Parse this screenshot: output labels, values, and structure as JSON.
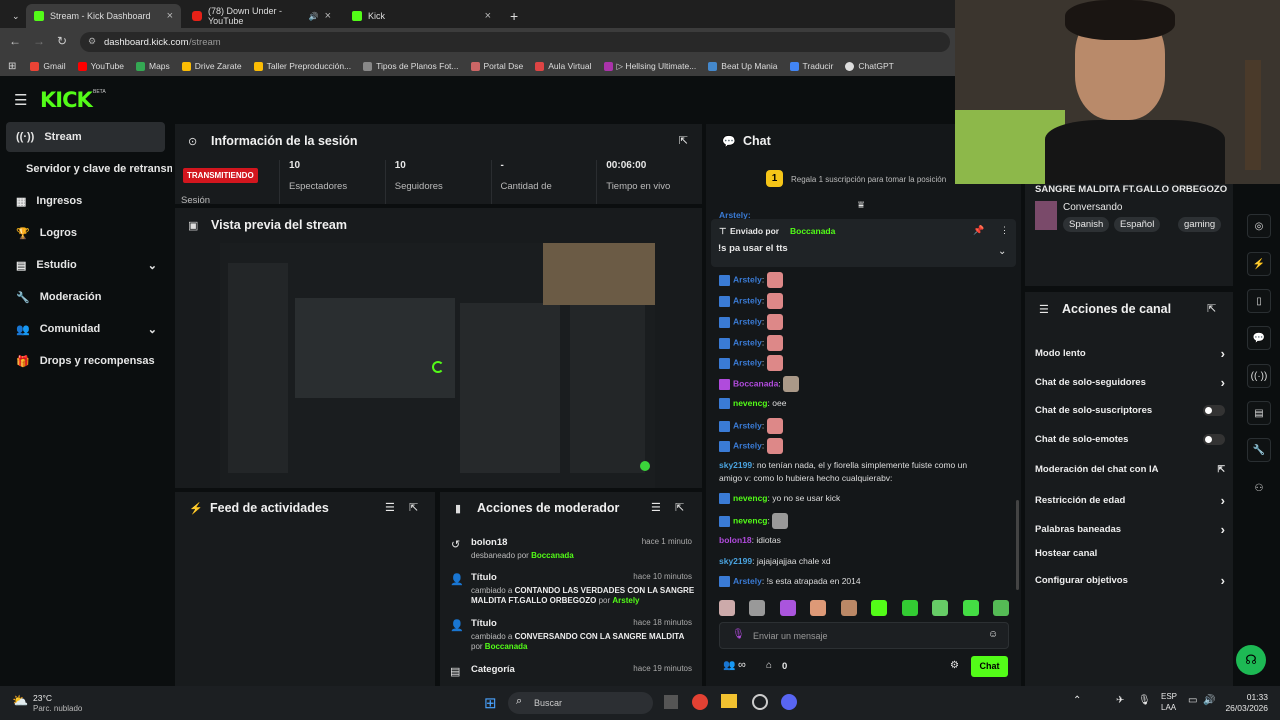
{
  "browser": {
    "tabs": [
      {
        "label": "Stream - Kick Dashboard"
      },
      {
        "label": "(78) Down Under - YouTube"
      },
      {
        "label": "Kick"
      }
    ],
    "url_domain": "dashboard.kick.com",
    "url_path": "/stream",
    "bookmarks": [
      "Gmail",
      "YouTube",
      "Maps",
      "Drive Zarate",
      "Taller Preproducción...",
      "Tipos de Planos Fot...",
      "Portal Dse",
      "Aula Virtual",
      "▷ Hellsing Ultimate...",
      "Beat Up Mania",
      "Traducir",
      "ChatGPT"
    ]
  },
  "kick": {
    "logo": "KICK",
    "beta": "BETA"
  },
  "sidebar": {
    "items": [
      "Stream",
      "Servidor y clave de retransmisión",
      "Ingresos",
      "Logros",
      "Estudio",
      "Moderación",
      "Comunidad",
      "Drops y recompensas"
    ]
  },
  "session": {
    "title": "Información de la sesión",
    "badge": "TRANSMITIENDO",
    "label": "Sesión",
    "stats": [
      {
        "value": "10",
        "label": "Espectadores"
      },
      {
        "value": "10",
        "label": "Seguidores"
      },
      {
        "value": "-",
        "label": "Cantidad de"
      },
      {
        "value": "00:06:00",
        "label": "Tiempo en vivo"
      }
    ]
  },
  "preview": {
    "title": "Vista previa del stream"
  },
  "feed": {
    "title": "Feed de actividades"
  },
  "modactions": {
    "title": "Acciones de moderador",
    "items": [
      {
        "title": "bolon18",
        "desc": "desbaneado por",
        "user": "Boccanada",
        "time": "hace 1 minuto"
      },
      {
        "title": "Título",
        "desc": "cambiado a",
        "bold": "CONTANDO LAS VERDADES CON LA SANGRE MALDITA FT.GALLO ORBEGOZO",
        "by": "por",
        "user": "Arstely",
        "time": "hace 10 minutos"
      },
      {
        "title": "Título",
        "desc": "cambiado a",
        "bold": "CONVERSANDO CON LA SANGRE MALDITA",
        "by": "por",
        "user": "Boccanada",
        "time": "hace 18 minutos"
      },
      {
        "title": "Categoría",
        "time": "hace 19 minutos"
      }
    ]
  },
  "chat": {
    "title": "Chat",
    "gift_count": "1",
    "gift_text": "Regala 1 suscripción para tomar la posición",
    "pinned_prefix": "Enviado por",
    "pinned_user": "Boccanada",
    "pinned_msg": "!s pa usar el tts",
    "partial_user": "Arstely:",
    "messages": [
      {
        "user": "Arstely",
        "text": ""
      },
      {
        "user": "Arstely",
        "text": ""
      },
      {
        "user": "Arstely",
        "text": ""
      },
      {
        "user": "Arstely",
        "text": ""
      },
      {
        "user": "Arstely",
        "text": ""
      },
      {
        "user": "Boccanada",
        "text": ""
      },
      {
        "user": "nevencg",
        "text": "oee"
      },
      {
        "user": "Arstely",
        "text": ""
      },
      {
        "user": "Arstely",
        "text": ""
      },
      {
        "user": "sky2199",
        "text": "no tenían nada, el y fiorella simplemente fuiste como un"
      },
      {
        "user": "",
        "text": "amigo v: como lo hubiera hecho cualquierabv:"
      },
      {
        "user": "nevencg",
        "text": "yo no se usar kick"
      },
      {
        "user": "nevencg",
        "text": ""
      },
      {
        "user": "bolon18",
        "text": "idiotas"
      },
      {
        "user": "sky2199",
        "text": "jajajajajjaa chale xd"
      },
      {
        "user": "Arstely",
        "text": "!s esta atrapada en 2014"
      }
    ],
    "placeholder": "Enviar un mensaje",
    "infinite": "∞",
    "points": "0",
    "send": "Chat"
  },
  "streaminfo": {
    "title": "SANGRE MALDITA FT.GALLO ORBEGOZO",
    "category": "Conversando",
    "tags": [
      "Spanish",
      "Español",
      "gaming"
    ]
  },
  "channel": {
    "title": "Acciones de canal",
    "rows": [
      {
        "label": "Modo lento",
        "kind": "chev"
      },
      {
        "label": "Chat de solo-seguidores",
        "kind": "chev"
      },
      {
        "label": "Chat de solo-suscriptores",
        "kind": "toggle"
      },
      {
        "label": "Chat de solo-emotes",
        "kind": "toggle"
      },
      {
        "label": "Moderación del chat con IA",
        "kind": "ext"
      },
      {
        "label": "Restricción de edad",
        "kind": "chev"
      },
      {
        "label": "Palabras baneadas",
        "kind": "chev"
      },
      {
        "label": "Hostear canal",
        "kind": "none"
      },
      {
        "label": "Configurar objetivos",
        "kind": "chev"
      }
    ]
  },
  "taskbar": {
    "temp": "23°C",
    "weather": "Parc. nublado",
    "search": "Buscar",
    "lang1": "ESP",
    "lang2": "LAA",
    "time": "01:33",
    "date": "26/03/2026"
  },
  "colors": {
    "accent": "#53fc18",
    "live": "#d2161e",
    "panel": "#181b1d",
    "bg": "#0b0e0f"
  }
}
